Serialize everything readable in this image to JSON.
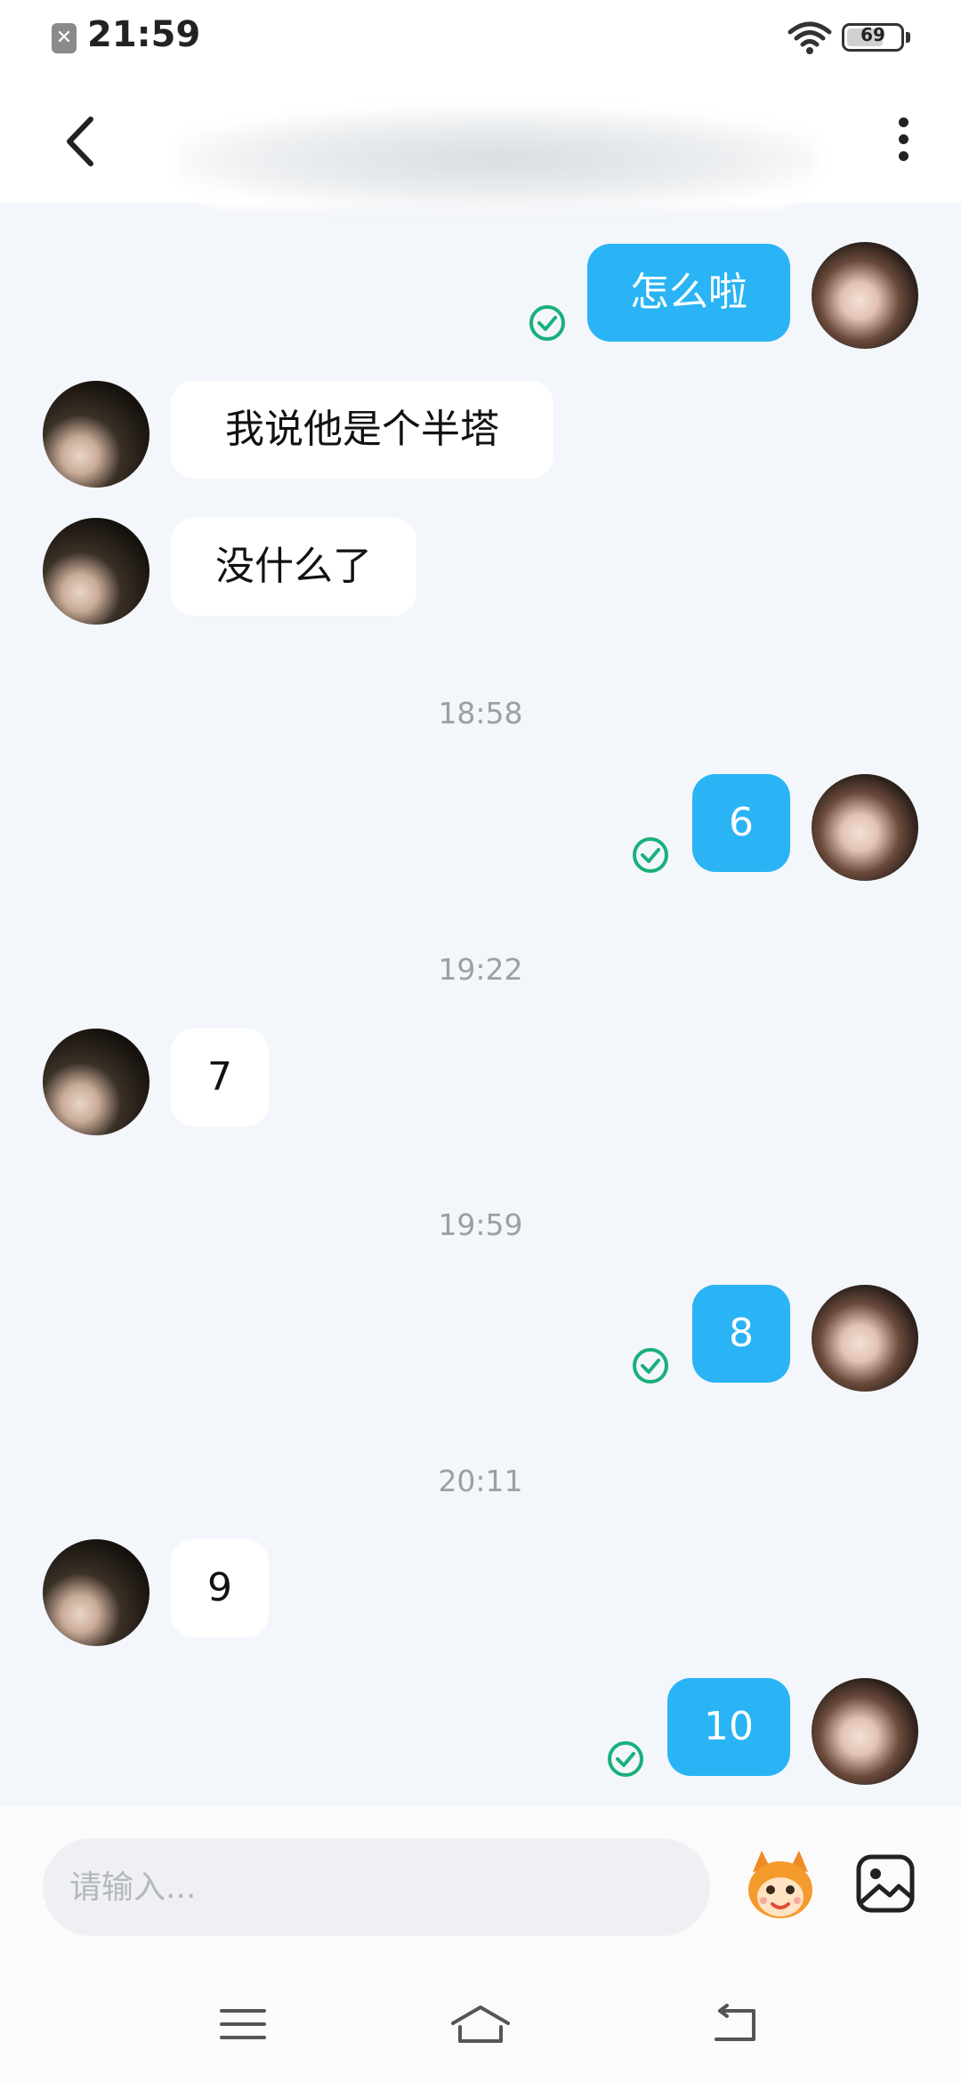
{
  "status_bar": {
    "time": "21:59",
    "battery": "69",
    "battery_fraction": 0.69
  },
  "header": {
    "back_icon": "chevron-left-icon",
    "more_icon": "more-vertical-icon"
  },
  "messages": [
    {
      "sender": "self",
      "text": "怎么啦",
      "status": "read"
    },
    {
      "sender": "other",
      "text": "我说他是个半塔"
    },
    {
      "sender": "other",
      "text": "没什么了"
    },
    {
      "type": "time",
      "text": "18:58"
    },
    {
      "sender": "self",
      "text": "6",
      "status": "read"
    },
    {
      "type": "time",
      "text": "19:22"
    },
    {
      "sender": "other",
      "text": "7"
    },
    {
      "type": "time",
      "text": "19:59"
    },
    {
      "sender": "self",
      "text": "8",
      "status": "read"
    },
    {
      "type": "time",
      "text": "20:11"
    },
    {
      "sender": "other",
      "text": "9"
    },
    {
      "sender": "self",
      "text": "10",
      "status": "read"
    }
  ],
  "input": {
    "placeholder": "请输入..."
  },
  "colors": {
    "self_bubble": "#2ab4f5",
    "other_bubble": "#ffffff",
    "background": "#f3f6fb",
    "read_check": "#19b07a"
  },
  "icons": {
    "emoji": "emoji-sticker-icon",
    "image": "image-icon",
    "nav_menu": "menu-icon",
    "nav_home": "home-icon",
    "nav_back": "back-icon"
  }
}
